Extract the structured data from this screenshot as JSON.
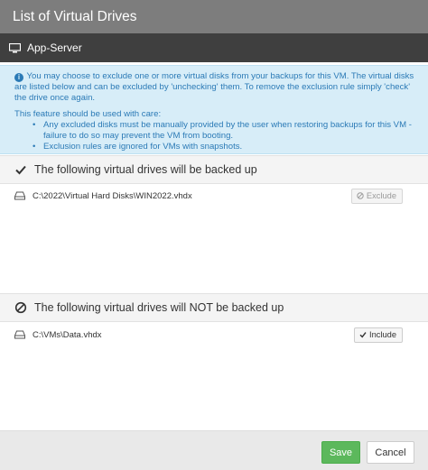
{
  "dialog": {
    "title": "List of Virtual Drives"
  },
  "server": {
    "name": "App-Server",
    "icon": "monitor-icon"
  },
  "info": {
    "message": "You may choose to exclude one or more virtual disks from your backups for this VM. The virtual disks are listed below and can be excluded by 'unchecking' them. To remove the exclusion rule simply 'check' the drive once again.",
    "caution_heading": "This feature should be used with care:",
    "bullets": [
      "Any excluded disks must be manually provided by the user when restoring backups for this VM - failure to do so may prevent the VM from booting.",
      "Exclusion rules are ignored for VMs with snapshots."
    ]
  },
  "included_section": {
    "header": "The following virtual drives will be backed up",
    "icon": "check-icon",
    "drives": [
      {
        "path": "C:\\2022\\Virtual Hard Disks\\WIN2022.vhdx",
        "action_label": "Exclude",
        "action_icon": "ban-icon",
        "action_enabled": false
      }
    ]
  },
  "excluded_section": {
    "header": "The following virtual drives will NOT be backed up",
    "icon": "ban-icon",
    "drives": [
      {
        "path": "C:\\VMs\\Data.vhdx",
        "action_label": "Include",
        "action_icon": "check-icon",
        "action_enabled": true
      }
    ]
  },
  "footer": {
    "save_label": "Save",
    "cancel_label": "Cancel",
    "save_color": "#5cb85c"
  }
}
